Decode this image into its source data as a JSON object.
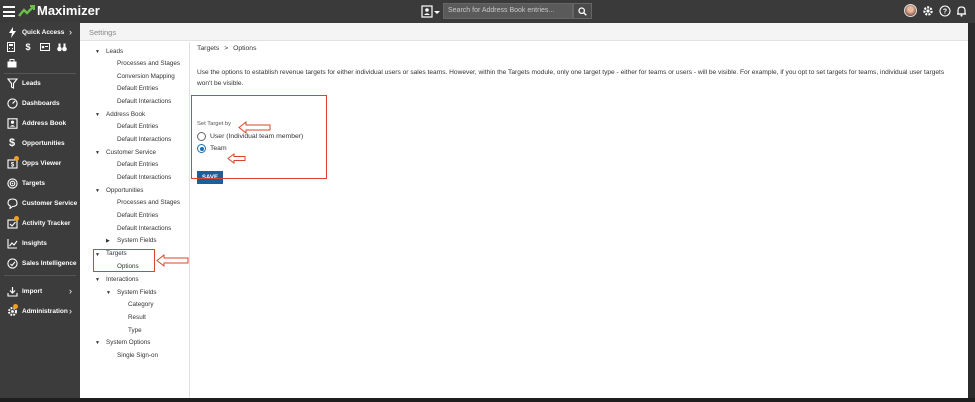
{
  "app": {
    "logo_text": "Maximizer",
    "brand_color": "#6cc04a"
  },
  "topbar": {
    "search_placeholder": "Search for Address Book entries..."
  },
  "nav": {
    "quick_access": "Quick Access",
    "items": [
      {
        "label": "Leads",
        "icon": "funnel-icon"
      },
      {
        "label": "Dashboards",
        "icon": "dashboard-icon"
      },
      {
        "label": "Address Book",
        "icon": "address-book-icon"
      },
      {
        "label": "Opportunities",
        "icon": "dollar-icon"
      },
      {
        "label": "Opps Viewer",
        "icon": "opps-viewer-icon"
      },
      {
        "label": "Targets",
        "icon": "target-icon"
      },
      {
        "label": "Customer Service",
        "icon": "customer-service-icon"
      },
      {
        "label": "Activity Tracker",
        "icon": "activity-tracker-icon"
      },
      {
        "label": "Insights",
        "icon": "insights-icon"
      },
      {
        "label": "Sales Intelligence",
        "icon": "sales-intelligence-icon"
      }
    ],
    "import": "Import",
    "administration": "Administration"
  },
  "settings": {
    "title": "Settings"
  },
  "tree": {
    "leads": "Leads",
    "leads_processes": "Processes and Stages",
    "leads_conversion": "Conversion Mapping",
    "leads_default_entries": "Default Entries",
    "leads_default_interactions": "Default Interactions",
    "address_book": "Address Book",
    "ab_default_entries": "Default Entries",
    "ab_default_interactions": "Default Interactions",
    "customer_service": "Customer Service",
    "cs_default_entries": "Default Entries",
    "cs_default_interactions": "Default Interactions",
    "opportunities": "Opportunities",
    "opp_processes": "Processes and Stages",
    "opp_default_entries": "Default Entries",
    "opp_default_interactions": "Default Interactions",
    "opp_system_fields": "System Fields",
    "targets": "Targets",
    "targets_options": "Options",
    "interactions": "Interactions",
    "int_system_fields": "System Fields",
    "int_category": "Category",
    "int_result": "Result",
    "int_type": "Type",
    "system_options": "System Options",
    "sso": "Single Sign-on"
  },
  "content": {
    "breadcrumb_1": "Targets",
    "breadcrumb_sep": ">",
    "breadcrumb_2": "Options",
    "description": "Use the options to establish revenue targets for either individual users or sales teams. However, within the Targets module, only one target type - either for teams or users - will be visible. For example, if you opt to set targets for teams, individual user targets won't be visible.",
    "set_target_by": "Set Target by",
    "option_user": "User (Individual team member)",
    "option_team": "Team",
    "selected_option": "Team",
    "save_label": "SAVE"
  },
  "colors": {
    "annotation_red": "#d9452b",
    "save_blue": "#1c5f9c",
    "radio_blue": "#1a6fb5"
  }
}
